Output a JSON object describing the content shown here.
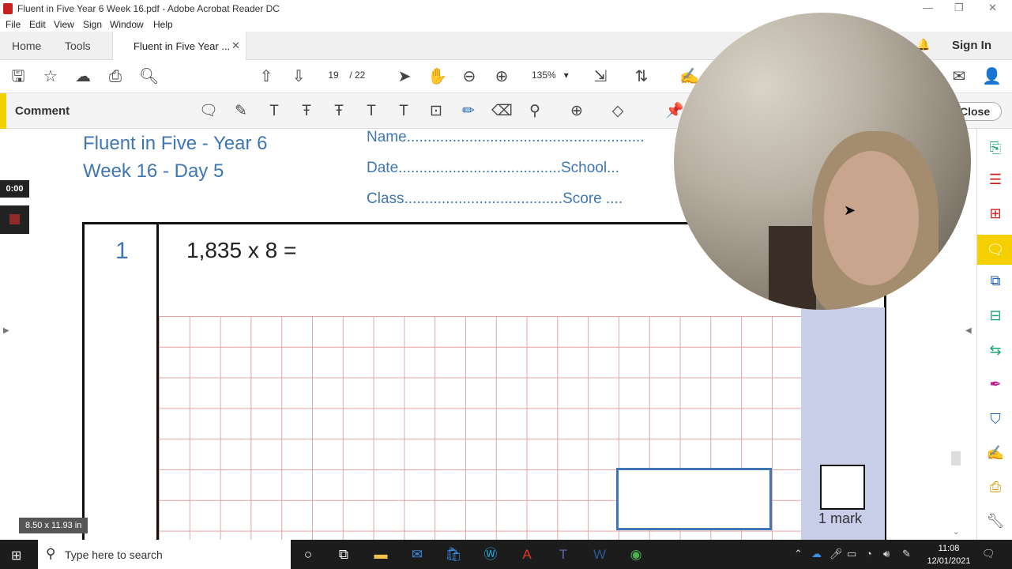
{
  "window": {
    "title": "Fluent in Five Year 6 Week 16.pdf - Adobe Acrobat Reader DC"
  },
  "menu": [
    "File",
    "Edit",
    "View",
    "Sign",
    "Window",
    "Help"
  ],
  "tabs": {
    "home": "Home",
    "tools": "Tools",
    "document": "Fluent in Five Year ...",
    "sign_in": "Sign In"
  },
  "toolbar": {
    "page_current": "19",
    "page_total": "/ 22",
    "zoom": "135%"
  },
  "comment": {
    "label": "Comment",
    "close": "Close"
  },
  "document": {
    "title_line1": "Fluent in Five - Year 6",
    "title_line2": "Week 16 - Day 5",
    "name_line": "Name.........................................................",
    "date_line": "Date.......................................School...",
    "class_line": "Class......................................Score ....",
    "question_number": "1",
    "question_text": "1,835 x 8 =",
    "mark_label": "1 mark"
  },
  "recorder": {
    "time": "0:00"
  },
  "page_size": "8.50 x 11.93 in",
  "taskbar": {
    "search_placeholder": "Type here to search",
    "time": "11:08",
    "date": "12/01/2021"
  }
}
